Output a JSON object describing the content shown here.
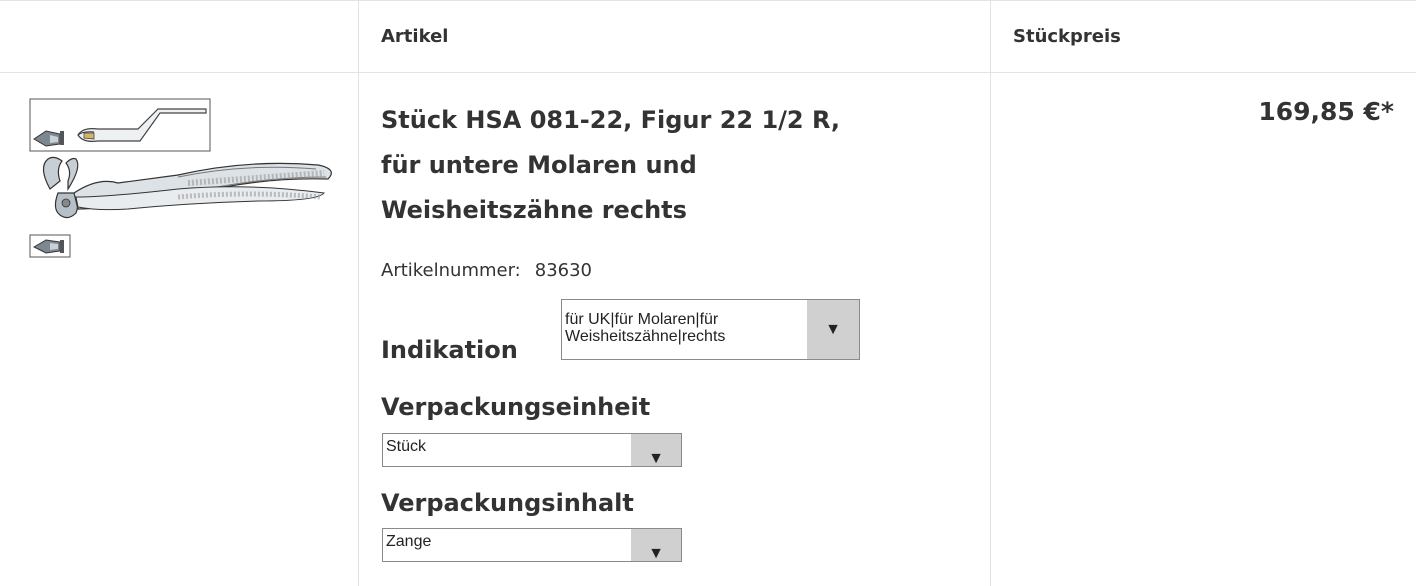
{
  "table_header": {
    "article_label": "Artikel",
    "unit_price_label": "Stückpreis"
  },
  "product": {
    "image_icon": "dental-extraction-forceps-image",
    "title_lines": [
      "Stück HSA 081-22, Figur 22 1/2 R,",
      "für untere Molaren und",
      "Weisheitszähne rechts"
    ],
    "sku_label": "Artikelnummer:",
    "sku_value": "83630",
    "price": "169,85 €*"
  },
  "options": {
    "indication": {
      "label": "Indikation",
      "value_lines": [
        "für UK|für Molaren|für",
        "Weisheitszähne|rechts"
      ],
      "arrow_icon": "triangle-down-icon"
    },
    "packaging_unit": {
      "label": "Verpackungseinheit",
      "value": "Stück",
      "arrow_icon": "triangle-down-icon"
    },
    "packaging_content": {
      "label": "Verpackungsinhalt",
      "value": "Zange",
      "arrow_icon": "triangle-down-icon"
    }
  },
  "colors": {
    "text": "#333333",
    "border": "#e3e3e3",
    "select_arrow_bg": "#d0d0d0"
  }
}
